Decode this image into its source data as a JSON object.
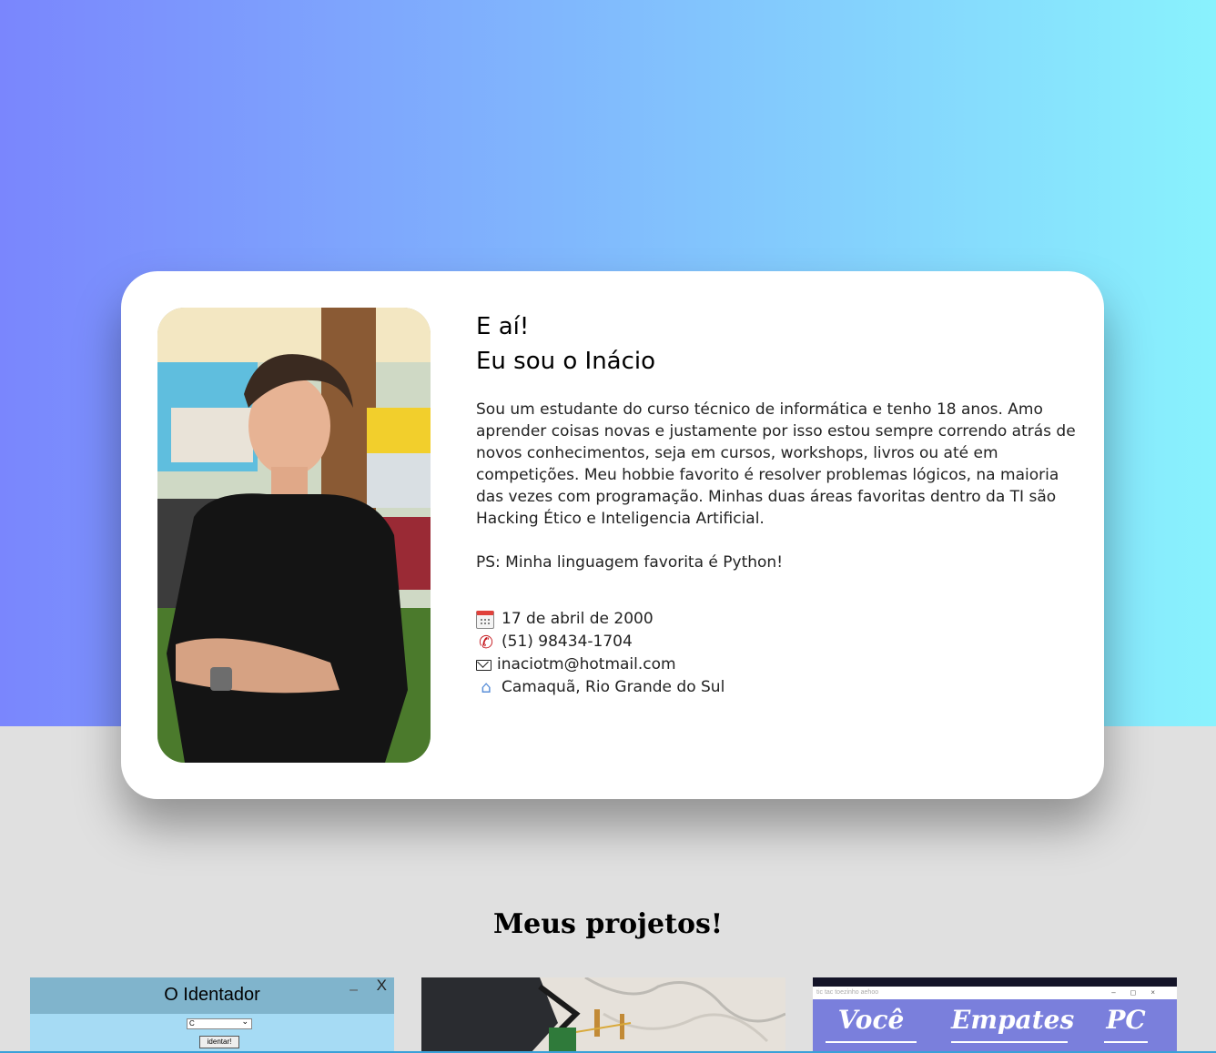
{
  "profile": {
    "greeting_line1": "E aí!",
    "greeting_line2": "Eu sou o Inácio",
    "bio": "Sou um estudante do curso técnico de informática e tenho 18 anos. Amo aprender coisas novas e justamente por isso estou sempre correndo atrás de novos conhecimentos, seja em cursos, workshops, livros ou até em competições. Meu hobbie favorito é resolver problemas lógicos, na maioria das vezes com programação. Minhas duas áreas favoritas dentro da TI são Hacking Ético e Inteligencia Artificial.",
    "ps": "PS: Minha linguagem favorita é Python!",
    "contacts": {
      "birthday": "17 de abril de 2000",
      "phone": "(51) 98434-1704",
      "email": "inaciotm@hotmail.com",
      "location": "Camaquã, Rio Grande do Sul"
    },
    "icons": {
      "birthday": "calendar-icon",
      "phone": "phone-icon",
      "email": "envelope-icon",
      "location": "house-icon"
    }
  },
  "projects": {
    "title": "Meus projetos!",
    "items": [
      {
        "window_title": "O Identador",
        "minimize": "–",
        "close": "X",
        "select_value": "C",
        "button_label": "identar!"
      },
      {
        "caption": ""
      },
      {
        "titlebar": "tic tac toezinho aehoo",
        "controls": "–◻×",
        "labels": [
          "Você",
          "Empates",
          "PC"
        ]
      }
    ]
  },
  "colors": {
    "hero_gradient_start": "#7a86fd",
    "hero_gradient_end": "#89f2fd",
    "page_background": "#e0e0e0",
    "card_background": "#ffffff"
  }
}
